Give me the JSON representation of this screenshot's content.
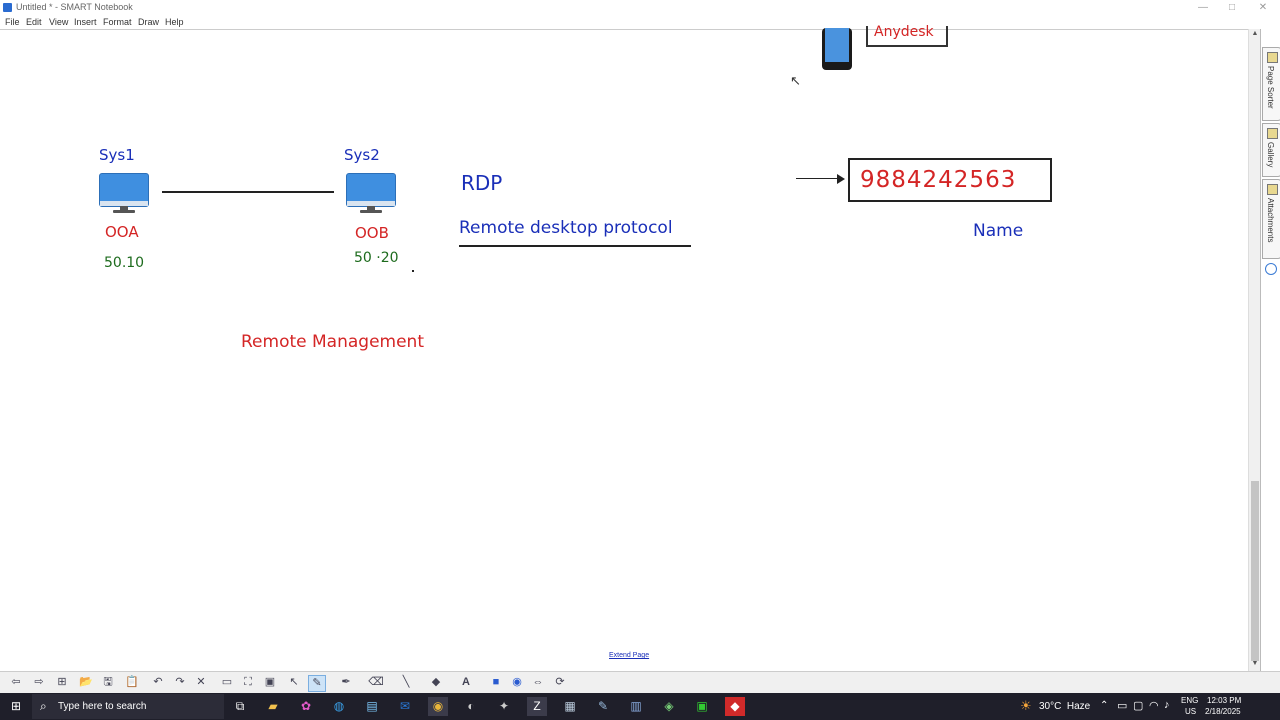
{
  "window": {
    "title": "Untitled * - SMART Notebook",
    "minimize": "—",
    "maximize": "□",
    "close": "✕"
  },
  "menu": [
    "File",
    "Edit",
    "View",
    "Insert",
    "Format",
    "Draw",
    "Help"
  ],
  "canvas": {
    "anydesk_label": "Anydesk",
    "sys1": {
      "name": "Sys1",
      "label": "OOA",
      "ip": "50.10"
    },
    "sys2": {
      "name": "Sys2",
      "label": "OOB",
      "ip": "50 ·20"
    },
    "rdp_acronym": "RDP",
    "rdp_full": "Remote desktop protocol",
    "remote_management": "Remote Management",
    "id_number": "9884242563",
    "name_label": "Name",
    "extend_page": "Extend Page",
    "cursor": "↖"
  },
  "side_tabs": [
    "Page Sorter",
    "Gallery",
    "Attachments"
  ],
  "toolbar_icons": [
    "back-icon",
    "forward-icon",
    "add-page-icon",
    "open-icon",
    "save-icon",
    "paste-icon",
    "undo-icon",
    "redo-icon",
    "delete-icon",
    "screen-shade-icon",
    "full-screen-icon",
    "capture-icon",
    "select-icon",
    "pen-icon",
    "creative-pen-icon",
    "eraser-icon",
    "line-icon",
    "shapes-icon",
    "text-icon",
    "fill-icon",
    "properties-icon",
    "move-toolbar-icon"
  ],
  "taskbar": {
    "search_placeholder": "Type here to search",
    "weather": "30°C  Haze",
    "lang_top": "ENG",
    "lang_bottom": "US",
    "time": "12:03 PM",
    "date": "2/18/2025"
  },
  "colors": {
    "ink_blue": "#1a2fb8",
    "ink_red": "#d42525",
    "ink_green": "#1d6b1d",
    "monitor_blue": "#3f8fe0",
    "taskbar_bg": "#1f1f2a"
  }
}
